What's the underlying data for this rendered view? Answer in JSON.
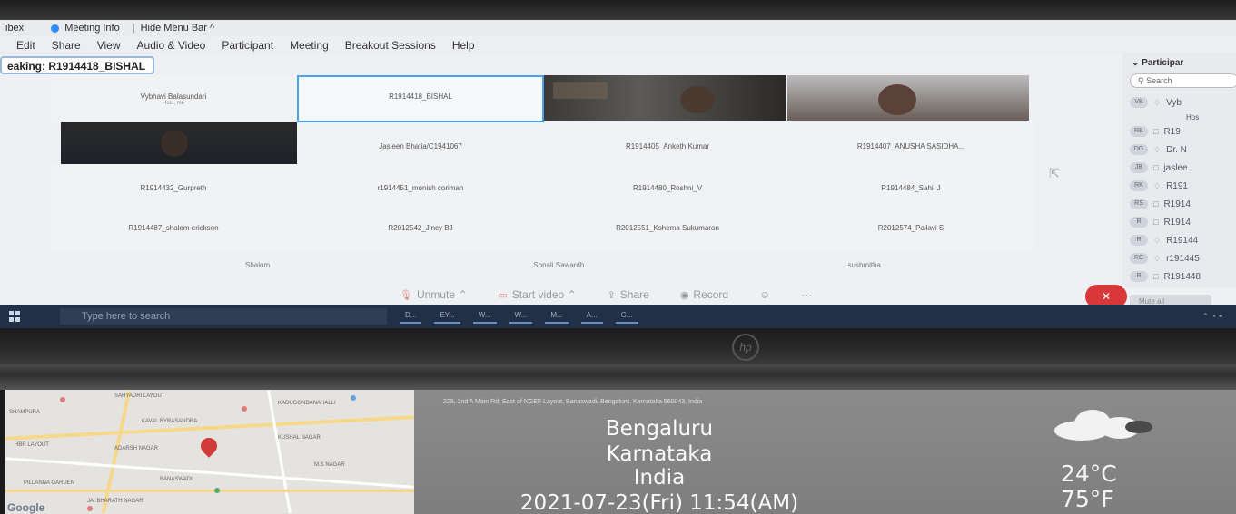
{
  "window": {
    "title_left": "ibex",
    "meeting_info": "Meeting Info",
    "hide_menu_bar": "Hide Menu Bar ^"
  },
  "menu": [
    "Edit",
    "Share",
    "View",
    "Audio & Video",
    "Participant",
    "Meeting",
    "Breakout Sessions",
    "Help"
  ],
  "speaking": "eaking: R1914418_BISHAL",
  "tiles": {
    "vybhavi": {
      "name": "Vybhavi Balasundari",
      "sub": "Host, me"
    },
    "bishal": {
      "name": "R1914418_BISHAL"
    },
    "jasleen": {
      "name": "Jasleen Bhatia/C1941067"
    },
    "anketh": {
      "name": "R1914405_Anketh Kumar"
    },
    "anusha": {
      "name": "R1914407_ANUSHA SASIDHA..."
    },
    "gurpreeth": {
      "name": "R1914432_Gurpreth"
    },
    "monish": {
      "name": "r1914451_monish coriman"
    },
    "roshni": {
      "name": "R1914480_Roshni_V"
    },
    "sahil": {
      "name": "R1914484_Sahil J"
    },
    "shalom_erickson": {
      "name": "R1914487_shalom erickson"
    },
    "jincy": {
      "name": "R2012542_Jincy BJ"
    },
    "kshema": {
      "name": "R2012551_Kshema Sukumaran"
    },
    "pallavi": {
      "name": "R2012574_Pallavi S"
    }
  },
  "bottom_names": [
    "Shalom",
    "Sonali Sawardh",
    "sushmitha"
  ],
  "controls": {
    "unmute": "Unmute",
    "start_video": "Start video",
    "share": "Share",
    "record": "Record",
    "end": "✕"
  },
  "participants_panel": {
    "title": "Participar",
    "search": "Search",
    "rows": [
      {
        "initials": "VB",
        "name": "Vyb",
        "sub": "Hos"
      },
      {
        "initials": "RB",
        "name": "R19"
      },
      {
        "initials": "DG",
        "name": "Dr. N"
      },
      {
        "initials": "JB",
        "name": "jaslee"
      },
      {
        "initials": "RK",
        "name": "R191"
      },
      {
        "initials": "RS",
        "name": "R1914"
      },
      {
        "initials": "R",
        "name": "R1914"
      },
      {
        "initials": "R",
        "name": "R19144"
      },
      {
        "initials": "RC",
        "name": "r191445"
      },
      {
        "initials": "R",
        "name": "R191448"
      }
    ],
    "mute_all": "Mute all"
  },
  "taskbar": {
    "search_placeholder": "Type here to search",
    "items": [
      "D...",
      "EY...",
      "W...",
      "W...",
      "M...",
      "A...",
      "G..."
    ]
  },
  "hp_logo": "hp",
  "map": {
    "labels": [
      "SAHYADRI LAYOUT",
      "SHAMPURA",
      "KAVAL BYRASANDRA",
      "KADUGONDANAHALLI",
      "HBR LAYOUT",
      "ADARSH NAGAR",
      "KUSHAL NAGAR",
      "M.S NAGAR",
      "BANASWADI",
      "PILLANNA GARDEN",
      "JAI BHARATH NAGAR"
    ],
    "brand": "Google"
  },
  "overlay": {
    "address": "229, 2nd A Main Rd, East of NGEF Layout, Banaswadi, Bengaluru, Karnataka 560043, India",
    "city": "Bengaluru",
    "state": "Karnataka",
    "country": "India",
    "datetime": "2021-07-23(Fri)   11:54(AM)",
    "temp_c": "24°C",
    "temp_f": "75°F"
  }
}
